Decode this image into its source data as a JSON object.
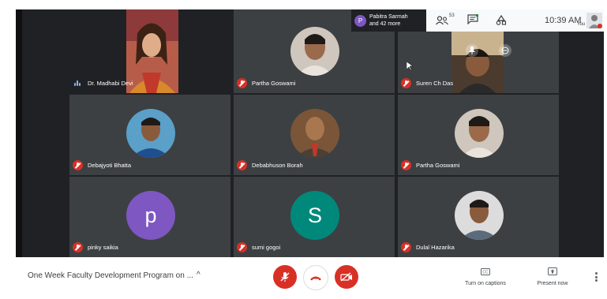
{
  "participants": [
    {
      "name": "Dr. Madhabi Devi",
      "muted": false
    },
    {
      "name": "Partha Goswami",
      "muted": true
    },
    {
      "name": "Suren Ch Das",
      "muted": true
    },
    {
      "name": "Debajyoti Bhatta",
      "muted": true
    },
    {
      "name": "Debabhuson Borah",
      "muted": true
    },
    {
      "name": "Partha Goswami",
      "muted": true
    },
    {
      "name": "pinky saikia",
      "muted": true,
      "initial": "p",
      "avatar_color": "#7e57c2"
    },
    {
      "name": "sumi gogoi",
      "muted": true,
      "initial": "S",
      "avatar_color": "#00897b"
    },
    {
      "name": "Dulal Hazarika",
      "muted": true
    }
  ],
  "top_bar": {
    "presenter_initial": "P",
    "presenter_line1": "Pabitra Sarmah",
    "presenter_line2": "and 42 more",
    "participant_count": "53",
    "time": "10:39 AM",
    "self_label": "You"
  },
  "bottom_bar": {
    "meeting_title": "One Week Faculty Development Program on ...",
    "captions_label": "Turn on captions",
    "present_label": "Present now"
  },
  "colors": {
    "meet_bg": "#202124",
    "tile_bg": "#3c4043",
    "muted_red": "#d93025",
    "accent_blue": "#8ab4f8"
  }
}
